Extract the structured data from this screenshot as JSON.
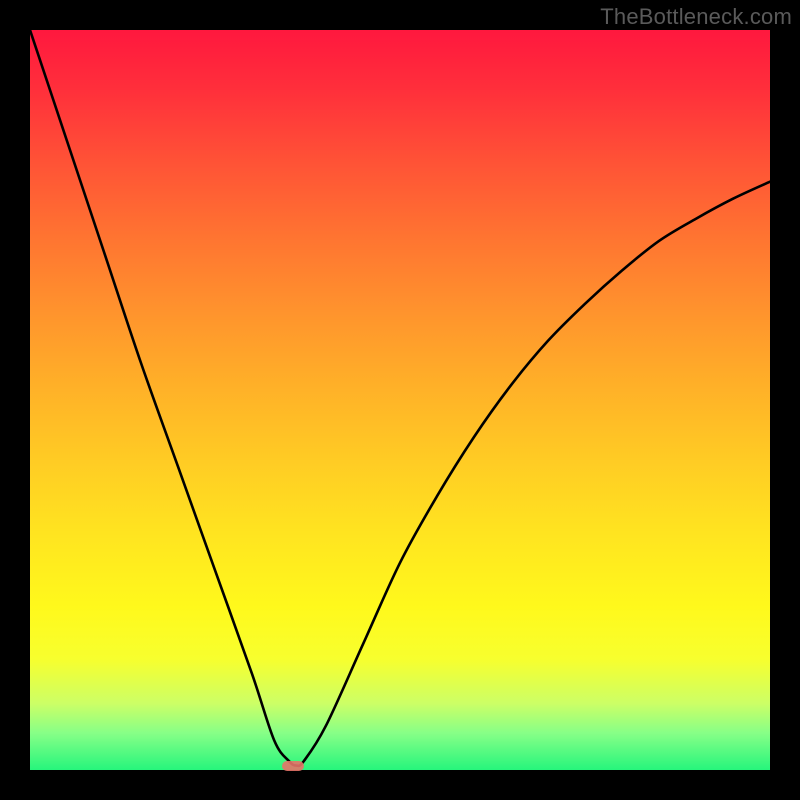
{
  "watermark": "TheBottleneck.com",
  "colors": {
    "frame_bg": "#000000",
    "curve_stroke": "#000000",
    "marker_fill": "#e57368"
  },
  "chart_data": {
    "type": "line",
    "title": "",
    "xlabel": "",
    "ylabel": "",
    "xlim": [
      0,
      100
    ],
    "ylim": [
      0,
      100
    ],
    "grid": false,
    "legend": false,
    "annotations": [
      "TheBottleneck.com"
    ],
    "series": [
      {
        "name": "bottleneck-curve",
        "x": [
          0,
          5,
          10,
          15,
          20,
          25,
          30,
          33,
          35,
          36,
          37,
          40,
          45,
          50,
          55,
          60,
          65,
          70,
          75,
          80,
          85,
          90,
          95,
          100
        ],
        "values": [
          100,
          85,
          70,
          55,
          41,
          27,
          13,
          4,
          1.2,
          0.6,
          1.2,
          6,
          17,
          28,
          37,
          45,
          52,
          58,
          63,
          67.5,
          71.5,
          74.5,
          77.2,
          79.5
        ]
      }
    ],
    "marker": {
      "x": 35.5,
      "y": 0.6
    }
  }
}
